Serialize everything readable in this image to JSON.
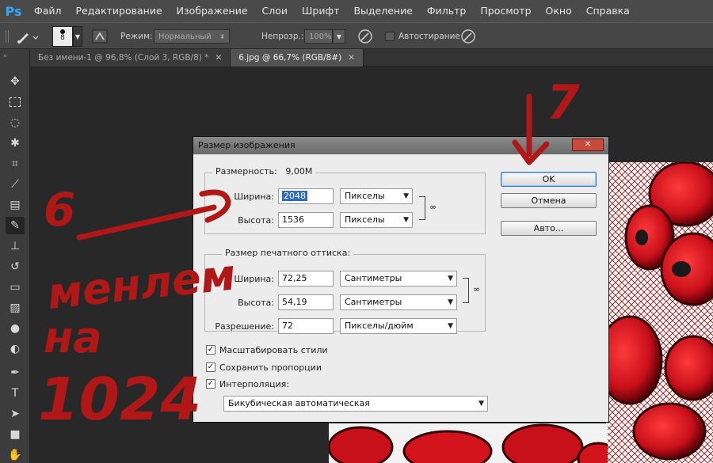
{
  "app": {
    "logo": "Ps"
  },
  "menu": [
    "Файл",
    "Редактирование",
    "Изображение",
    "Слои",
    "Шрифт",
    "Выделение",
    "Фильтр",
    "Просмотр",
    "Окно",
    "Справка"
  ],
  "options": {
    "brush_size": "8",
    "mode_label": "Режим:",
    "mode_value": "Нормальный",
    "opacity_label": "Непрозр.:",
    "opacity_value": "100%",
    "autoerase_label": "Автостирание"
  },
  "tabs": [
    {
      "label": "Без имени-1 @ 96,8% (Слой 3, RGB/8) *",
      "active": false
    },
    {
      "label": "6.jpg @ 66,7% (RGB/8#)",
      "active": true
    }
  ],
  "dialog": {
    "title": "Размер изображения",
    "pixel_dims": {
      "label": "Размерность:",
      "value": "9,00M",
      "width_label": "Ширина:",
      "width_value": "2048",
      "width_unit": "Пикселы",
      "height_label": "Высота:",
      "height_value": "1536",
      "height_unit": "Пикселы"
    },
    "doc_size": {
      "label": "Размер печатного оттиска:",
      "width_label": "Ширина:",
      "width_value": "72,25",
      "width_unit": "Сантиметры",
      "height_label": "Высота:",
      "height_value": "54,19",
      "height_unit": "Сантиметры",
      "res_label": "Разрешение:",
      "res_value": "72",
      "res_unit": "Пикселы/дюйм"
    },
    "buttons": {
      "ok": "OK",
      "cancel": "Отмена",
      "auto": "Авто..."
    },
    "checkboxes": [
      {
        "label": "Масштабировать стили",
        "checked": true
      },
      {
        "label": "Сохранить пропорции",
        "checked": true
      },
      {
        "label": "Интерполяция:",
        "checked": true
      }
    ],
    "interpolation": "Бикубическая автоматическая"
  },
  "annotations": {
    "step6": "6",
    "step7": "7",
    "handwritten_lines": [
      "менлем",
      "на",
      "1024"
    ]
  },
  "colors": {
    "accent": "#31a8ff",
    "annotation": "#b01818",
    "fractal_red": "#d4141c"
  }
}
